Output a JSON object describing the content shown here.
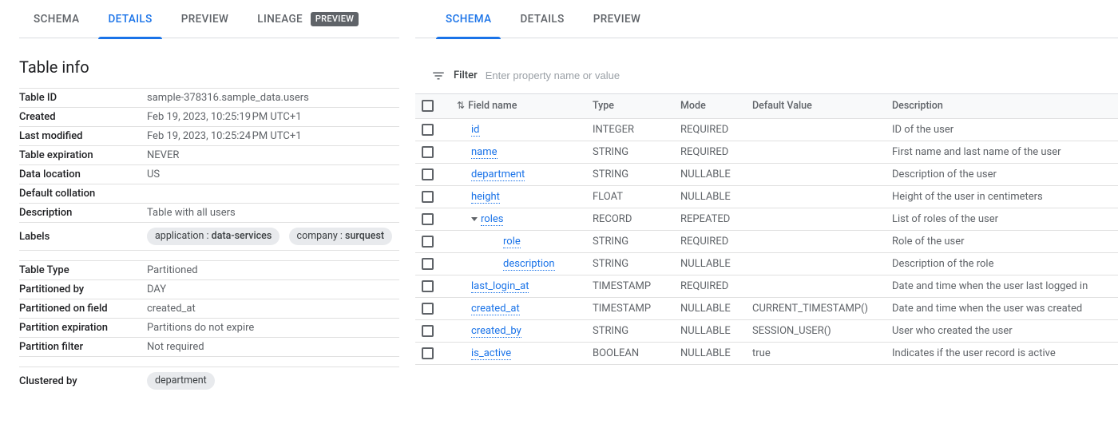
{
  "left": {
    "tabs": {
      "schema": "SCHEMA",
      "details": "DETAILS",
      "preview": "PREVIEW",
      "lineage": "LINEAGE",
      "lineage_badge": "PREVIEW"
    },
    "section_title": "Table info",
    "info1": {
      "table_id_label": "Table ID",
      "table_id_value": "sample-378316.sample_data.users",
      "created_label": "Created",
      "created_value": "Feb 19, 2023, 10:25:19 PM UTC+1",
      "modified_label": "Last modified",
      "modified_value": "Feb 19, 2023, 10:25:24 PM UTC+1",
      "expiration_label": "Table expiration",
      "expiration_value": "NEVER",
      "location_label": "Data location",
      "location_value": "US",
      "collation_label": "Default collation",
      "collation_value": "",
      "description_label": "Description",
      "description_value": "Table with all users",
      "labels_label": "Labels",
      "label1_key": "application",
      "label1_val": "data-services",
      "label2_key": "company",
      "label2_val": "surquest"
    },
    "info2": {
      "table_type_label": "Table Type",
      "table_type_value": "Partitioned",
      "partitioned_by_label": "Partitioned by",
      "partitioned_by_value": "DAY",
      "partitioned_on_label": "Partitioned on field",
      "partitioned_on_value": "created_at",
      "part_expiration_label": "Partition expiration",
      "part_expiration_value": "Partitions do not expire",
      "part_filter_label": "Partition filter",
      "part_filter_value": "Not required"
    },
    "info3": {
      "clustered_label": "Clustered by",
      "clustered_chip": "department"
    }
  },
  "right": {
    "tabs": {
      "schema": "SCHEMA",
      "details": "DETAILS",
      "preview": "PREVIEW"
    },
    "filter": {
      "label": "Filter",
      "placeholder": "Enter property name or value"
    },
    "headers": {
      "field": "Field name",
      "type": "Type",
      "mode": "Mode",
      "default": "Default Value",
      "desc": "Description"
    },
    "rows": [
      {
        "indent": 1,
        "name": "id",
        "type": "INTEGER",
        "mode": "REQUIRED",
        "def": "",
        "desc": "ID of the user"
      },
      {
        "indent": 1,
        "name": "name",
        "type": "STRING",
        "mode": "REQUIRED",
        "def": "",
        "desc": "First name and last name of the user"
      },
      {
        "indent": 1,
        "name": "department",
        "type": "STRING",
        "mode": "NULLABLE",
        "def": "",
        "desc": "Description of the user"
      },
      {
        "indent": 1,
        "name": "height",
        "type": "FLOAT",
        "mode": "NULLABLE",
        "def": "",
        "desc": "Height of the user in centimeters"
      },
      {
        "indent": 1,
        "expandable": true,
        "name": "roles",
        "type": "RECORD",
        "mode": "REPEATED",
        "def": "",
        "desc": "List of roles of the user"
      },
      {
        "indent": 2,
        "name": "role",
        "type": "STRING",
        "mode": "REQUIRED",
        "def": "",
        "desc": "Role of the user"
      },
      {
        "indent": 2,
        "name": "description",
        "type": "STRING",
        "mode": "NULLABLE",
        "def": "",
        "desc": "Description of the role"
      },
      {
        "indent": 1,
        "name": "last_login_at",
        "type": "TIMESTAMP",
        "mode": "REQUIRED",
        "def": "",
        "desc": "Date and time when the user last logged in"
      },
      {
        "indent": 1,
        "name": "created_at",
        "type": "TIMESTAMP",
        "mode": "NULLABLE",
        "def": "CURRENT_TIMESTAMP()",
        "desc": "Date and time when the user was created"
      },
      {
        "indent": 1,
        "name": "created_by",
        "type": "STRING",
        "mode": "NULLABLE",
        "def": "SESSION_USER()",
        "desc": "User who created the user"
      },
      {
        "indent": 1,
        "name": "is_active",
        "type": "BOOLEAN",
        "mode": "NULLABLE",
        "def": "true",
        "desc": "Indicates if the user record is active"
      }
    ]
  }
}
